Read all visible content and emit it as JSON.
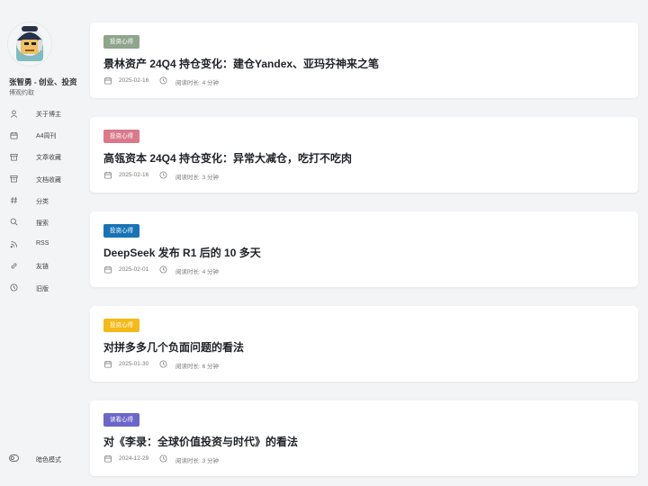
{
  "author": {
    "name": "张智勇 - 创业、投资",
    "subtitle": "博观约取"
  },
  "nav": [
    {
      "label": "关于博主",
      "icon": "user-icon"
    },
    {
      "label": "A4周刊",
      "icon": "calendar-icon"
    },
    {
      "label": "文章收藏",
      "icon": "archive-icon"
    },
    {
      "label": "文档收藏",
      "icon": "archive-icon"
    },
    {
      "label": "分类",
      "icon": "hash-icon"
    },
    {
      "label": "搜索",
      "icon": "search-icon"
    },
    {
      "label": "RSS",
      "icon": "rss-icon"
    },
    {
      "label": "友链",
      "icon": "link-icon"
    },
    {
      "label": "旧版",
      "icon": "clock-icon"
    }
  ],
  "dark_mode_label": "暗色模式",
  "posts": [
    {
      "tag": "投资心得",
      "tag_color": "#8fa58c",
      "title": "景林资产 24Q4 持仓变化：建仓Yandex、亚玛芬神来之笔",
      "date": "2025-02-16",
      "read": "阅读时长: 4 分钟"
    },
    {
      "tag": "投资心得",
      "tag_color": "#d9798a",
      "title": "高瓴资本 24Q4 持仓变化：异常大减仓，吃打不吃肉",
      "date": "2025-02-16",
      "read": "阅读时长: 3 分钟"
    },
    {
      "tag": "投资心得",
      "tag_color": "#1873b5",
      "title": "DeepSeek 发布 R1 后的 10 多天",
      "date": "2025-02-01",
      "read": "阅读时长: 4 分钟"
    },
    {
      "tag": "投资心得",
      "tag_color": "#f5b918",
      "title": "对拼多多几个负面问题的看法",
      "date": "2025-01-30",
      "read": "阅读时长: 6 分钟"
    },
    {
      "tag": "读看心得",
      "tag_color": "#6b66c9",
      "title": "对《李录：全球价值投资与时代》的看法",
      "date": "2024-12-29",
      "read": "阅读时长: 3 分钟"
    }
  ]
}
